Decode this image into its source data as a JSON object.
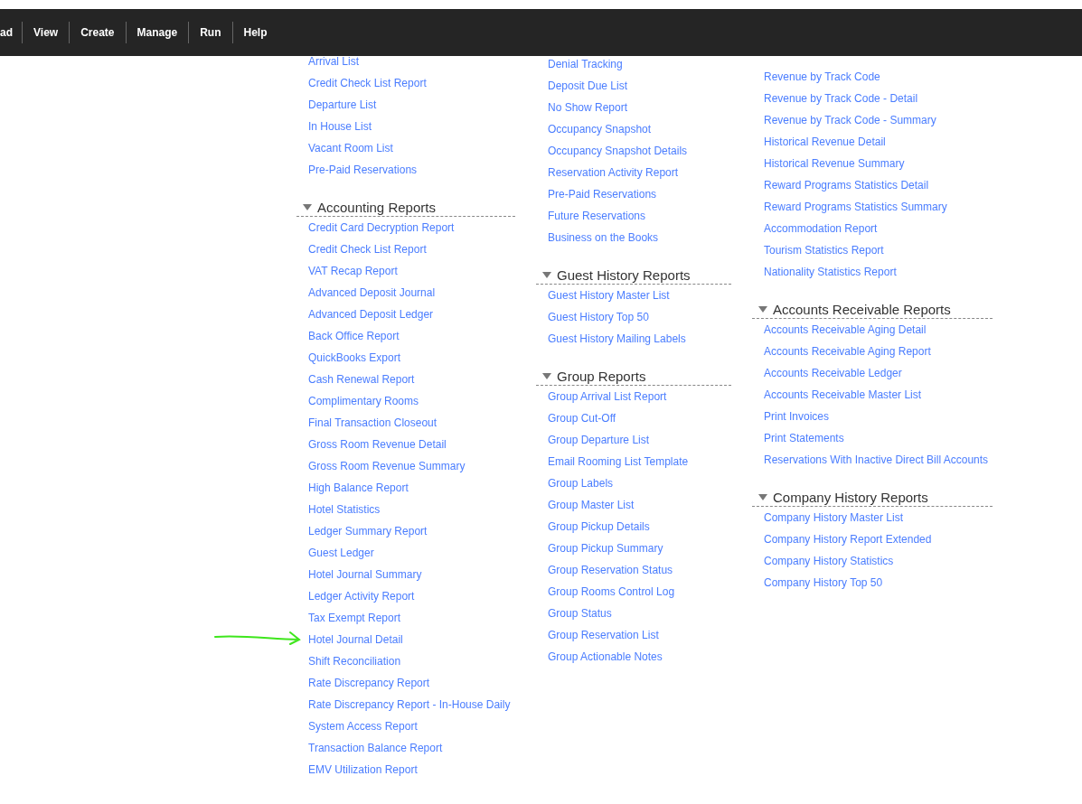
{
  "menu": [
    {
      "label": "ad"
    },
    {
      "label": "View"
    },
    {
      "label": "Create"
    },
    {
      "label": "Manage"
    },
    {
      "label": "Run"
    },
    {
      "label": "Help"
    }
  ],
  "columns": [
    {
      "sections": [
        {
          "items": [
            "Arrival List",
            "Credit Check List Report",
            "Departure List",
            "In House List",
            "Vacant Room List",
            "Pre-Paid Reservations"
          ]
        },
        {
          "heading": "Accounting Reports",
          "items": [
            "Credit Card Decryption Report",
            "Credit Check List Report",
            "VAT Recap Report",
            "Advanced Deposit Journal",
            "Advanced Deposit Ledger",
            "Back Office Report",
            "QuickBooks Export",
            "Cash Renewal Report",
            "Complimentary Rooms",
            "Final Transaction Closeout",
            "Gross Room Revenue Detail",
            "Gross Room Revenue Summary",
            "High Balance Report",
            "Hotel Statistics",
            "Ledger Summary Report",
            "Guest Ledger",
            "Hotel Journal Summary",
            "Ledger Activity Report",
            "Tax Exempt Report",
            "Hotel Journal Detail",
            "Shift Reconciliation",
            "Rate Discrepancy Report",
            "Rate Discrepancy Report - In-House Daily",
            "System Access Report",
            "Transaction Balance Report",
            "EMV Utilization Report"
          ]
        }
      ]
    },
    {
      "sections": [
        {
          "items": [
            "Denial Tracking",
            "Deposit Due List",
            "No Show Report",
            "Occupancy Snapshot",
            "Occupancy Snapshot Details",
            "Reservation Activity Report",
            "Pre-Paid Reservations",
            "Future Reservations",
            "Business on the Books"
          ]
        },
        {
          "heading": "Guest History Reports",
          "items": [
            "Guest History Master List",
            "Guest History Top 50",
            "Guest History Mailing Labels"
          ]
        },
        {
          "heading": "Group Reports",
          "items": [
            "Group Arrival List Report",
            "Group Cut-Off",
            "Group Departure List",
            "Email Rooming List Template",
            "Group Labels",
            "Group Master List",
            "Group Pickup Details",
            "Group Pickup Summary",
            "Group Reservation Status",
            "Group Rooms Control Log",
            "Group Status",
            "Group Reservation List",
            "Group Actionable Notes"
          ]
        }
      ]
    },
    {
      "sections": [
        {
          "items": [
            "Revenue by Track Code",
            "Revenue by Track Code - Detail",
            "Revenue by Track Code - Summary",
            "Historical Revenue Detail",
            "Historical Revenue Summary",
            "Reward Programs Statistics Detail",
            "Reward Programs Statistics Summary",
            "Accommodation Report",
            "Tourism Statistics Report",
            "Nationality Statistics Report"
          ]
        },
        {
          "heading": "Accounts Receivable Reports",
          "items": [
            "Accounts Receivable Aging Detail",
            "Accounts Receivable Aging Report",
            "Accounts Receivable Ledger",
            "Accounts Receivable Master List",
            "Print Invoices",
            "Print Statements",
            "Reservations With Inactive Direct Bill Accounts"
          ]
        },
        {
          "heading": "Company History Reports",
          "items": [
            "Company History Master List",
            "Company History Report Extended",
            "Company History Statistics",
            "Company History Top 50"
          ]
        }
      ]
    }
  ]
}
